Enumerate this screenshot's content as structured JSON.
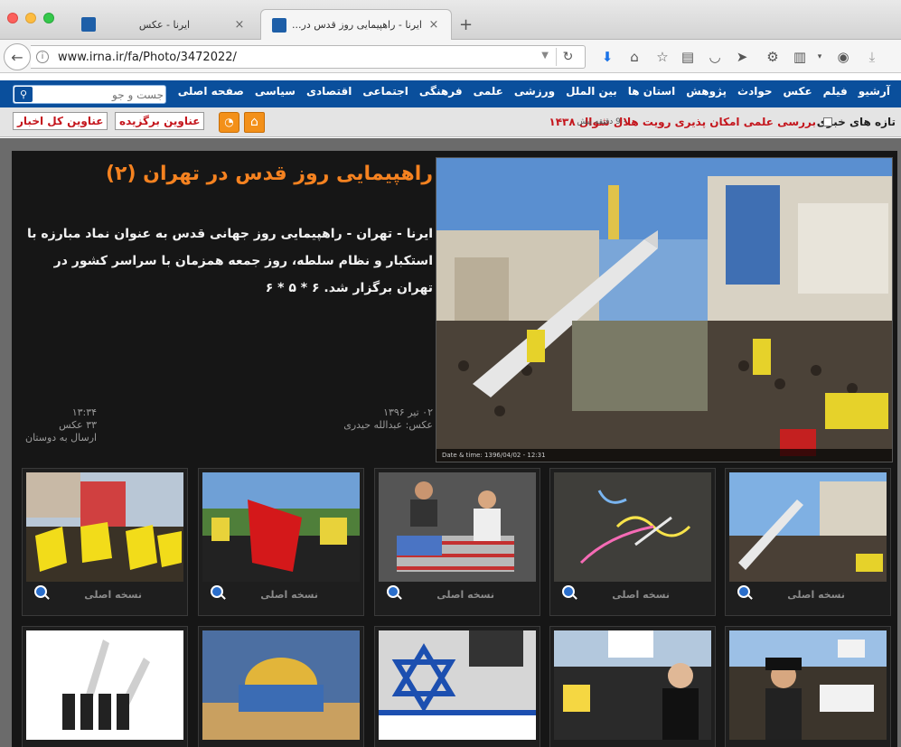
{
  "browser": {
    "tabs": [
      {
        "title": "ایرنا - عکس",
        "active": false
      },
      {
        "title": "ایرنا - راهپیمایی روز قدس در...",
        "active": true
      }
    ],
    "new_tab": "+",
    "url": "www.irna.ir/fa/Photo/3472022/"
  },
  "site": {
    "search_placeholder": "جست و جو",
    "menu": [
      "صفحه اصلی",
      "سیاسی",
      "اقتصادی",
      "اجتماعی",
      "فرهنگی",
      "علمی",
      "ورزشی",
      "بین الملل",
      "استان ها",
      "پژوهش",
      "حوادث",
      "عکس",
      "فیلم",
      "آرشیو"
    ],
    "ticker": {
      "label": "تازه های خبری",
      "text": "بررسی علمی امکان پذیری رویت هلال شوال ۱۴۳۸",
      "time": "- 9 دقیقه پیش"
    },
    "buttons": {
      "top_news": "عناوین برگزیده",
      "all_news": "عناوین کل اخبار"
    },
    "accent": "#f58220",
    "brand_blue": "#0a4f9c"
  },
  "article": {
    "headline": "راهپیمایی روز قدس در تهران (۲)",
    "lead": "ایرنا - تهران - راهپیمایی روز جهانی قدس به عنوان نماد مبارزه با استکبار و نظام سلطه، روز جمعه همزمان با سراسر کشور در تهران برگزار شد. ۶ * ۵ * ۶",
    "date": "۰۲ تیر ۱۳۹۶",
    "photographer": "عکس: عبدالله حیدری",
    "time": "۱۳:۳۴",
    "photo_count": "۳۳ عکس",
    "send": "ارسال به دوستان",
    "photo_caption": "Date & time: 1396/04/02 - 12:31"
  },
  "thumbnails": {
    "original_label": "نسخه اصلی",
    "row1": [
      "missile-float",
      "chalk-usa",
      "flag-burning-street",
      "red-flags-crowd",
      "yellow-flags-crowd"
    ],
    "row2": [
      "missile-crowd",
      "israel-star-street",
      "women-placards",
      "dome-rock-mosaic",
      "missiles-soldiers"
    ]
  }
}
